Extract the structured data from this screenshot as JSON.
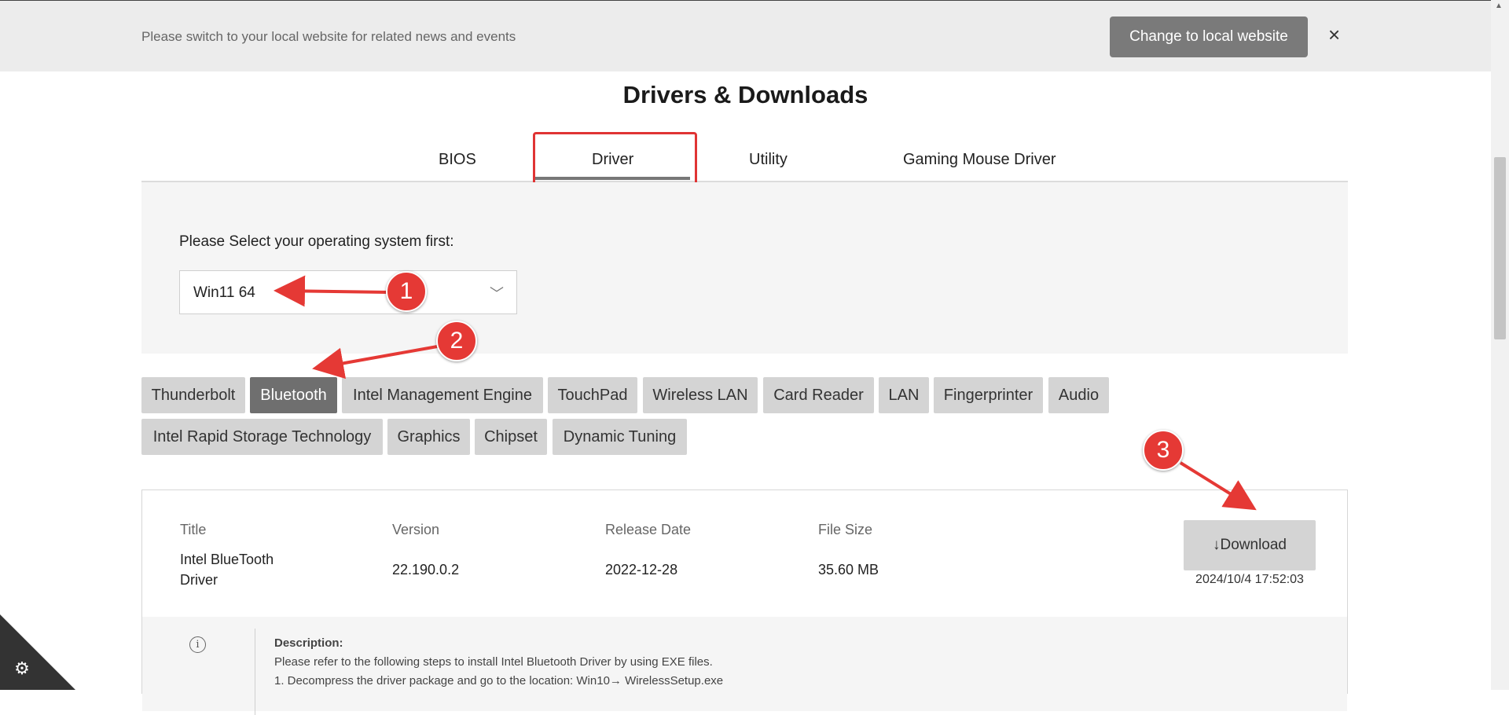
{
  "banner": {
    "text": "Please switch to your local website for related news and events",
    "button_label": "Change to local website",
    "close_glyph": "×"
  },
  "page": {
    "title": "Drivers & Downloads"
  },
  "tabs": [
    {
      "label": "BIOS",
      "active": false
    },
    {
      "label": "Driver",
      "active": true
    },
    {
      "label": "Utility",
      "active": false
    },
    {
      "label": "Gaming Mouse Driver",
      "active": false
    }
  ],
  "os": {
    "label": "Please Select your operating system first:",
    "selected": "Win11 64"
  },
  "categories": [
    {
      "label": "Thunderbolt",
      "active": false
    },
    {
      "label": "Bluetooth",
      "active": true
    },
    {
      "label": "Intel Management Engine",
      "active": false
    },
    {
      "label": "TouchPad",
      "active": false
    },
    {
      "label": "Wireless LAN",
      "active": false
    },
    {
      "label": "Card Reader",
      "active": false
    },
    {
      "label": "LAN",
      "active": false
    },
    {
      "label": "Fingerprinter",
      "active": false
    },
    {
      "label": "Audio",
      "active": false
    },
    {
      "label": "Intel Rapid Storage Technology",
      "active": false
    },
    {
      "label": "Graphics",
      "active": false
    },
    {
      "label": "Chipset",
      "active": false
    },
    {
      "label": "Dynamic Tuning",
      "active": false
    }
  ],
  "driver": {
    "headers": {
      "title": "Title",
      "version": "Version",
      "release_date": "Release Date",
      "file_size": "File Size"
    },
    "title_line1": "Intel BlueTooth",
    "title_line2": "Driver",
    "version": "22.190.0.2",
    "release_date": "2022-12-28",
    "file_size": "35.60 MB",
    "download_label": "↓Download",
    "timestamp": "2024/10/4 17:52:03",
    "description": {
      "title": "Description:",
      "lines": [
        "Please refer to the following steps to install Intel Bluetooth Driver by using EXE files.",
        "1. Decompress the driver package and go to the location: Win10→ WirelessSetup.exe"
      ]
    }
  },
  "annotations": [
    "1",
    "2",
    "3"
  ],
  "colors": {
    "accent_red": "#e53935",
    "banner_bg": "#ececec",
    "active_category": "#6f6f6f",
    "inactive_category": "#d4d4d4"
  }
}
